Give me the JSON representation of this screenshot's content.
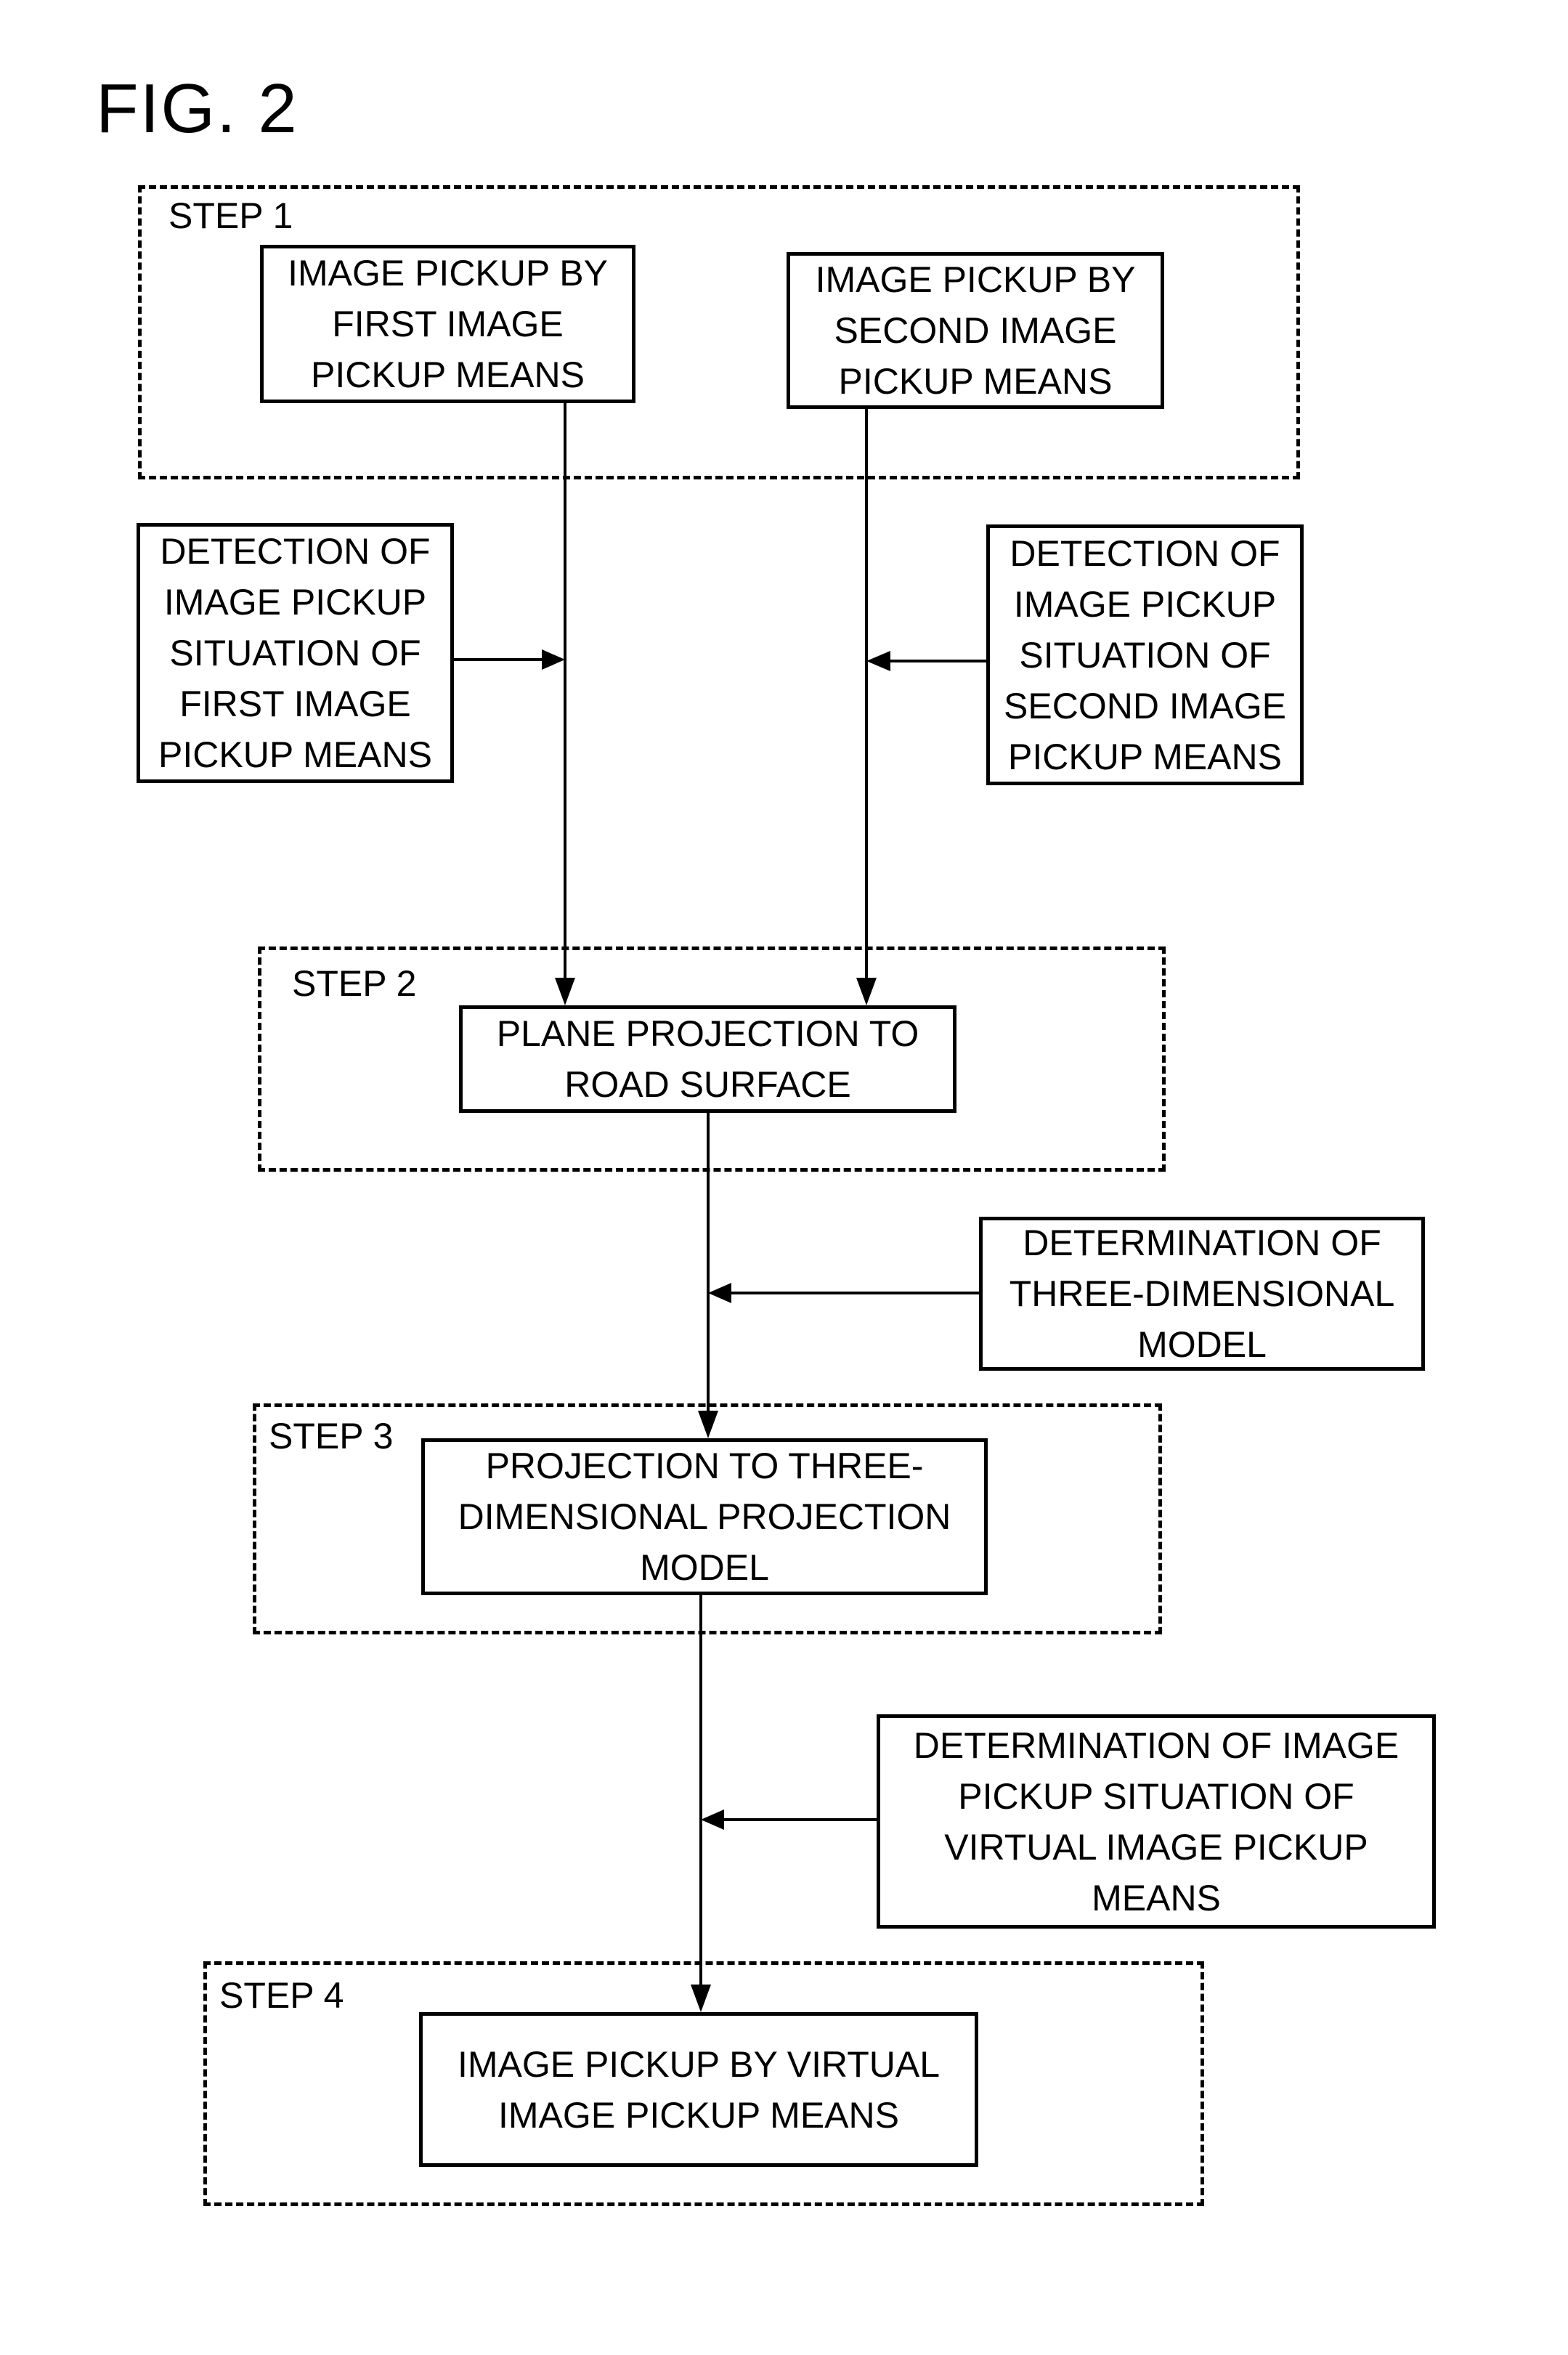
{
  "figure": {
    "title": "FIG. 2"
  },
  "steps": [
    {
      "label": "STEP  1"
    },
    {
      "label": "STEP  2"
    },
    {
      "label": "STEP  3"
    },
    {
      "label": "STEP  4"
    }
  ],
  "boxes": {
    "first_pickup": "IMAGE PICKUP BY\nFIRST IMAGE\nPICKUP MEANS",
    "second_pickup": "IMAGE PICKUP BY\nSECOND IMAGE\nPICKUP MEANS",
    "detect_first": "DETECTION OF\nIMAGE PICKUP\nSITUATION OF\nFIRST IMAGE\nPICKUP MEANS",
    "detect_second": "DETECTION OF\nIMAGE PICKUP\nSITUATION OF\nSECOND IMAGE\nPICKUP MEANS",
    "plane_projection": "PLANE PROJECTION TO\nROAD SURFACE",
    "determine_3d_model": "DETERMINATION OF\nTHREE-DIMENSIONAL\nMODEL",
    "projection_3d": "PROJECTION TO THREE-\nDIMENSIONAL PROJECTION\nMODEL",
    "determine_virtual": "DETERMINATION OF IMAGE\nPICKUP SITUATION OF\nVIRTUAL IMAGE PICKUP\nMEANS",
    "virtual_pickup": "IMAGE PICKUP BY VIRTUAL\nIMAGE PICKUP MEANS"
  }
}
